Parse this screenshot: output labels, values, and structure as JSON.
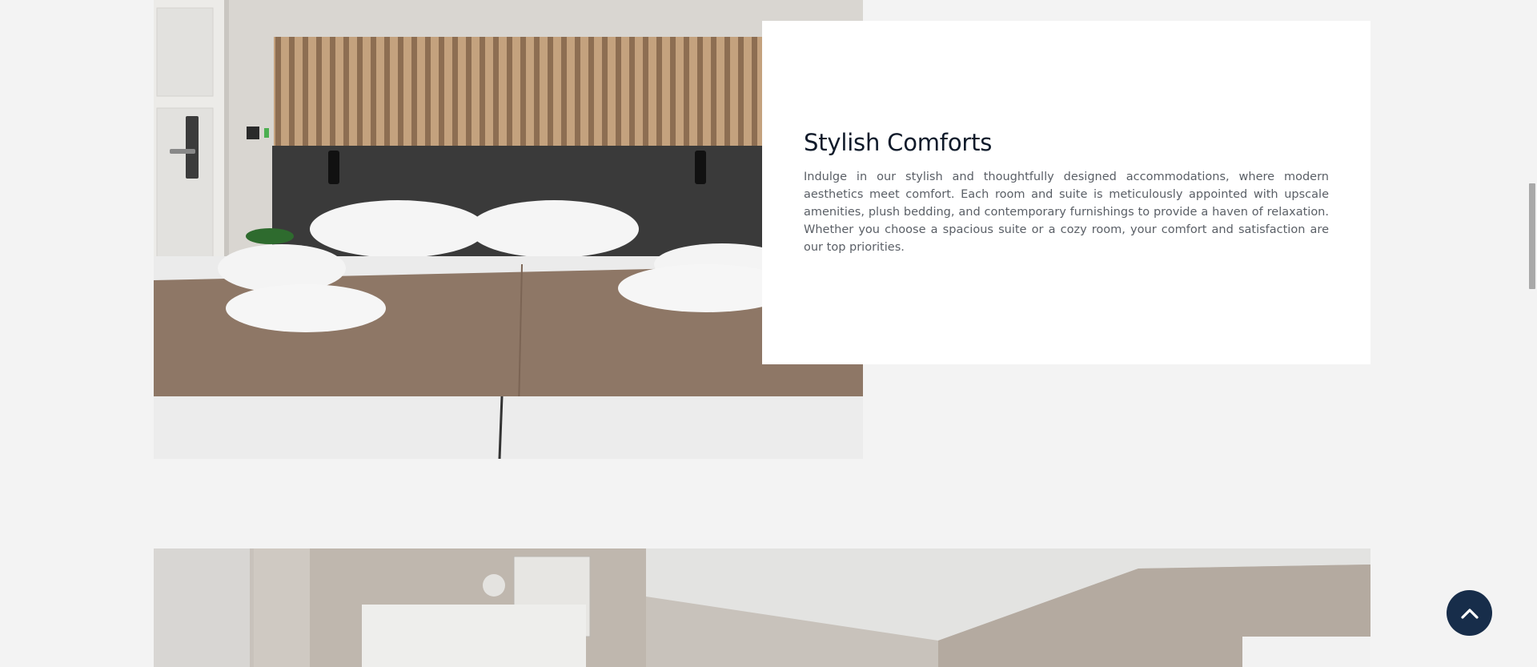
{
  "feature": {
    "title": "Stylish Comforts",
    "body": "Indulge in our stylish and thoughtfully designed accommodations, where modern aesthetics meet comfort. Each room and suite is meticulously appointed with upscale amenities, plush bedding, and contemporary furnishings to provide a haven of relaxation. Whether you choose a spacious suite or a cozy room, your comfort and satisfaction are our top priorities."
  },
  "images": {
    "room_photo_1": "bedroom-photo",
    "room_photo_2": "room-interior-photo"
  },
  "controls": {
    "back_to_top_icon": "chevron-up-icon"
  },
  "colors": {
    "page_background": "#f3f3f3",
    "card_background": "#ffffff",
    "title_color": "#0f1a2a",
    "body_color": "#5a5f66",
    "back_to_top_background": "#172d4a"
  }
}
